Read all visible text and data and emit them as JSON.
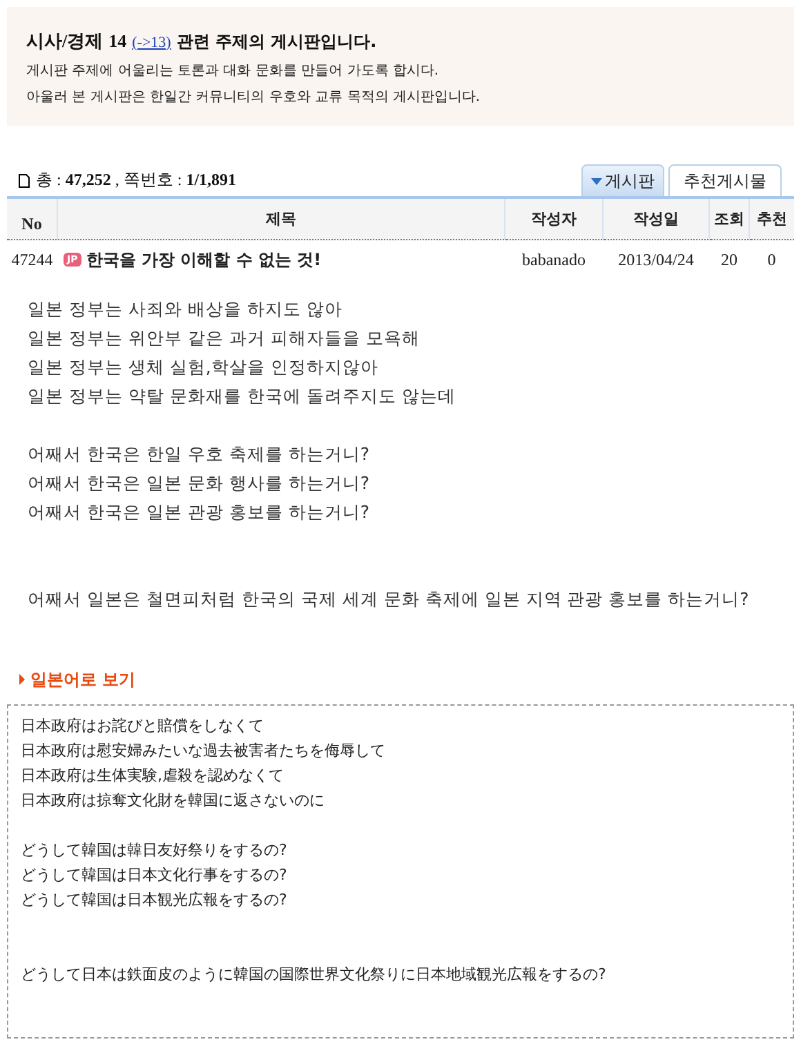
{
  "notice": {
    "category": "시사/경제",
    "number": "14",
    "link": "(->13)",
    "heading_rest": "관련 주제의 게시판입니다.",
    "lines": [
      "게시판 주제에 어울리는 토론과 대화 문화를 만들어 가도록 합시다.",
      "아울러 본 게시판은 한일간 커뮤니티의 우호와 교류 목적의 게시판입니다."
    ]
  },
  "summary": "총 : **47,252** , 쪽번호 : **1/1,891**",
  "tabs": [
    {
      "label": "게시판",
      "selected": true
    },
    {
      "label": "추천게시물",
      "selected": false
    }
  ],
  "table": {
    "columns": [
      "No",
      "제목",
      "작성자",
      "작성일",
      "조회",
      "추천"
    ],
    "rows": [
      {
        "no": "47244",
        "badge": "JP",
        "title": "한국을 가장 이해할 수 없는 것!",
        "author": "babanado",
        "date": "2013/04/24",
        "views": "20",
        "likes": "0"
      }
    ]
  },
  "post": {
    "paragraphs": [
      [
        "일본 정부는 사죄와 배상을 하지도 않아",
        "일본 정부는 위안부 같은 과거 피해자들을 모욕해",
        "일본 정부는 생체 실험,학살을 인정하지않아",
        "일본 정부는 약탈 문화재를 한국에 돌려주지도 않는데"
      ],
      [
        "어째서 한국은 한일 우호 축제를 하는거니?",
        "어째서 한국은 일본 문화 행사를 하는거니?",
        "어째서 한국은 일본 관광 홍보를 하는거니?"
      ],
      [
        "어째서 일본은 철면피처럼 한국의 국제 세계 문화 축제에 일본 지역 관광 홍보를 하는거니?"
      ]
    ]
  },
  "translation": {
    "link": "일본어로 보기",
    "paragraphs": [
      [
        "日本政府はお詫びと賠償をしなくて",
        "日本政府は慰安婦みたいな過去被害者たちを侮辱して",
        "日本政府は生体実験,虐殺を認めなくて",
        "日本政府は掠奪文化財を韓国に返さないのに"
      ],
      [
        "どうして韓国は韓日友好祭りをするの?",
        "どうして韓国は日本文化行事をするの?",
        "どうして韓国は日本観光広報をするの?"
      ],
      [
        "どうして日本は鉄面皮のように韓国の国際世界文化祭りに日本地域観光広報をするの?"
      ]
    ]
  }
}
